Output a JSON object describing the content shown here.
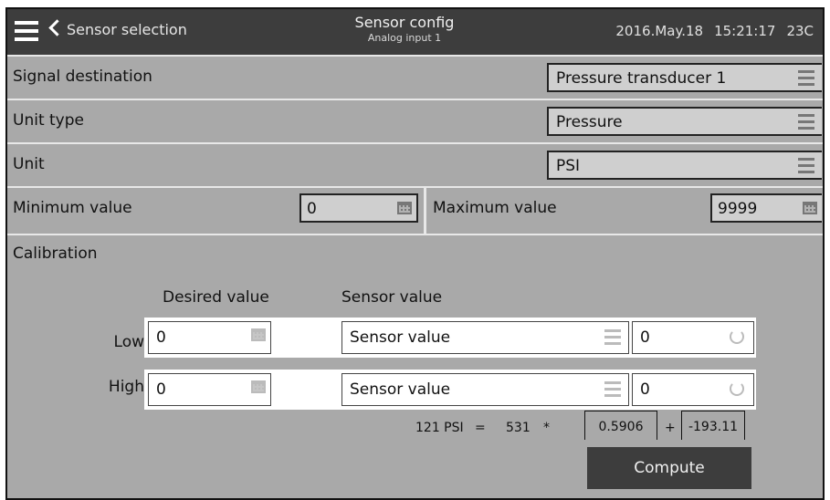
{
  "header": {
    "back_label": "Sensor selection",
    "title": "Sensor config",
    "subtitle": "Analog input 1",
    "date": "2016.May.18",
    "time": "15:21:17",
    "temp": "23C"
  },
  "fields": {
    "signal_destination": {
      "label": "Signal destination",
      "value": "Pressure transducer 1"
    },
    "unit_type": {
      "label": "Unit type",
      "value": "Pressure"
    },
    "unit": {
      "label": "Unit",
      "value": "PSI"
    },
    "minimum": {
      "label": "Minimum value",
      "value": "0"
    },
    "maximum": {
      "label": "Maximum value",
      "value": "9999"
    }
  },
  "calibration": {
    "title": "Calibration",
    "desired_header": "Desired value",
    "sensor_header": "Sensor value",
    "rows": [
      {
        "label": "Low",
        "desired": "0",
        "sensor_select": "Sensor value",
        "sensor_value": "0"
      },
      {
        "label": "High",
        "desired": "0",
        "sensor_select": "Sensor value",
        "sensor_value": "0"
      }
    ],
    "formula": {
      "result": "121 PSI",
      "equals": "=",
      "input": "531",
      "times": "*",
      "multiplier": "0.5906",
      "plus": "+",
      "offset": "-193.11"
    },
    "compute_label": "Compute"
  }
}
